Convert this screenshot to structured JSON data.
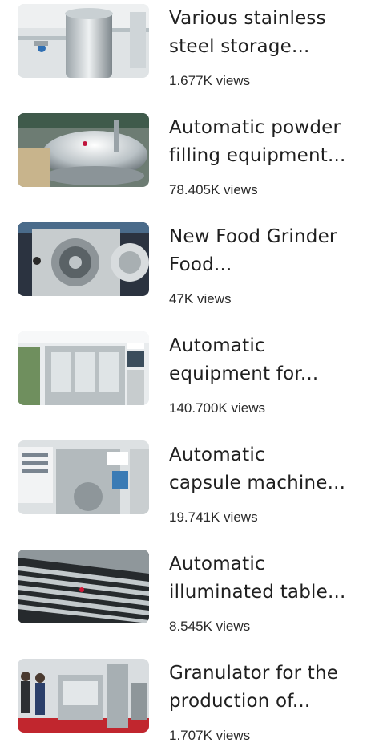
{
  "items": [
    {
      "title": "Various stainless\nsteel storage...",
      "views": "1.677K views",
      "thumb": "stainless-tank-filter-icon"
    },
    {
      "title": "Automatic powder\nfilling equipment...",
      "views": "78.405K views",
      "thumb": "steel-vessel-lid-icon"
    },
    {
      "title": "New Food Grinder\nFood...",
      "views": "47K views",
      "thumb": "grinder-machine-icon"
    },
    {
      "title": "Automatic\nequipment for...",
      "views": "140.700K views",
      "thumb": "exhibition-machine-icon"
    },
    {
      "title": "Automatic\ncapsule machine...",
      "views": "19.741K views",
      "thumb": "capsule-machine-icon"
    },
    {
      "title": "Automatic\nilluminated table...",
      "views": "8.545K views",
      "thumb": "illuminated-table-icon"
    },
    {
      "title": "Granulator for the\nproduction of...",
      "views": "1.707K views",
      "thumb": "granulator-machine-icon"
    }
  ]
}
